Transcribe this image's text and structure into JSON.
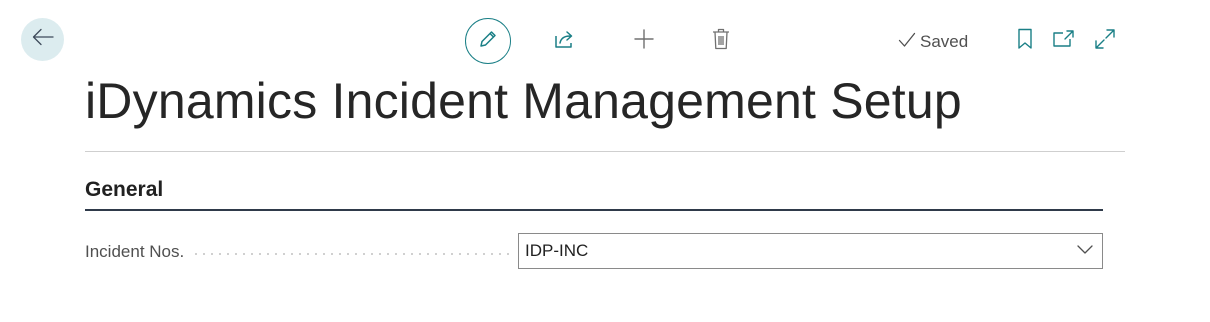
{
  "page": {
    "title": "iDynamics Incident Management Setup"
  },
  "toolbar": {
    "back_icon": "arrow-left-icon",
    "edit_icon": "pencil-icon",
    "share_icon": "share-icon",
    "new_icon": "plus-icon",
    "delete_icon": "trash-icon",
    "saved_label": "Saved",
    "bookmark_icon": "bookmark-icon",
    "popout_icon": "open-new-window-icon",
    "expand_icon": "expand-icon"
  },
  "sections": [
    {
      "header": "General",
      "fields": [
        {
          "label": "Incident Nos.",
          "value": "IDP-INC",
          "control": "dropdown"
        }
      ]
    }
  ],
  "colors": {
    "accent": "#1a7f86",
    "back_button_bg": "#dcecef",
    "section_rule": "#2f3a4a"
  }
}
